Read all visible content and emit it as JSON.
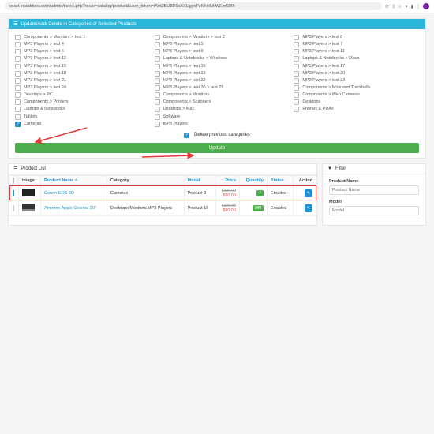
{
  "url": "ocart.vipaddons.com/admin/index.php?route=catalog/product&user_token=iAnt3BU8D6aXXUgyvPzIUnrSikWEmS0Ih",
  "panel": {
    "title": "Update/Add/ Delete in Categories of Selected Products"
  },
  "columns": [
    [
      "Components  >  Monitors  >  test 1",
      "MP3 Players  >  test 4",
      "MP3 Players  >  test 6",
      "MP3 Players  >  test 12",
      "MP3 Players  >  test 15",
      "MP3 Players  >  test 18",
      "MP3 Players  >  test 21",
      "MP3 Players  >  test 24",
      "Desktops  >  PC",
      "Components  >  Printers",
      "Laptops & Notebooks",
      "Tablets",
      "Cameras"
    ],
    [
      "Components  >  Monitors  >  test 2",
      "MP3 Players  >  test 5",
      "MP3 Players  >  test 9",
      "Laptops & Notebooks  >  Windows",
      "MP3 Players  >  test 16",
      "MP3 Players  >  test 19",
      "MP3 Players  >  test 22",
      "MP3 Players  >  test 20  >  test 25",
      "Components  >  Monitors",
      "Components  >  Scanners",
      "Desktops  >  Mac",
      "Software",
      "MP3 Players"
    ],
    [
      "MP3 Players  >  test 8",
      "MP3 Players  >  test 7",
      "MP3 Players  >  test 11",
      "Laptops & Notebooks  >  Macs",
      "MP3 Players  >  test 17",
      "MP3 Players  >  test 20",
      "MP3 Players  >  test 23",
      "Components  >  Mice and Trackballs",
      "Components  >  Web Cameras",
      "Desktops",
      "Phones & PDAs"
    ]
  ],
  "checked": {
    "col": 0,
    "row": 12
  },
  "delete_prev": {
    "label": "Delete previous categories",
    "checked": true
  },
  "update_label": "Update",
  "product_list_title": "Product List",
  "filter_title": "Filter",
  "table": {
    "headers": {
      "image": "Image",
      "name": "Product Name",
      "sort": "˄",
      "category": "Category",
      "model": "Model",
      "price": "Price",
      "qty": "Quantity",
      "status": "Status",
      "action": "Action"
    },
    "rows": [
      {
        "checked": true,
        "name": "Canon EOS 5D",
        "category": "Cameras",
        "model": "Product 3",
        "price_old": "$100.00",
        "price": "$80.00",
        "qty": "7",
        "status": "Enabled"
      },
      {
        "checked": false,
        "name": "Ammme Apple  Cinema 30\"",
        "category": "Desktops,Monitors,MP3 Players",
        "model": "Product 15",
        "price_old": "$100.00",
        "price": "$90.00",
        "qty": "988",
        "status": "Enabled"
      }
    ]
  },
  "filter": {
    "name_label": "Product Name",
    "name_ph": "Product Name",
    "model_label": "Model",
    "model_ph": "Model"
  }
}
